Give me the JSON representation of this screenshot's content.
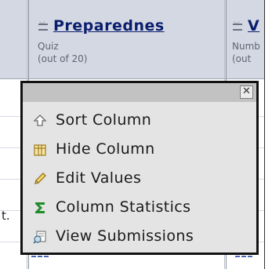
{
  "columns": [
    {
      "title": "Preparednes",
      "category": "Quiz",
      "out_of": "(out of 20)"
    },
    {
      "title": "V",
      "category": "Numb",
      "out_of": "(out"
    }
  ],
  "row_fragment": "t.",
  "menu": {
    "close_glyph": "✕",
    "items": [
      {
        "label": "Sort Column",
        "icon": "sort-arrow-icon"
      },
      {
        "label": "Hide Column",
        "icon": "hide-column-icon"
      },
      {
        "label": "Edit Values",
        "icon": "pencil-icon"
      },
      {
        "label": "Column Statistics",
        "icon": "sigma-icon"
      },
      {
        "label": "View Submissions",
        "icon": "submissions-icon"
      }
    ]
  },
  "colors": {
    "header_bg": "#d4d8e2",
    "menu_bg": "#e4e4e4",
    "menu_titlebar": "#c2c2c2",
    "link": "#0a1e6e",
    "sigma_green": "#1e8c2a"
  }
}
